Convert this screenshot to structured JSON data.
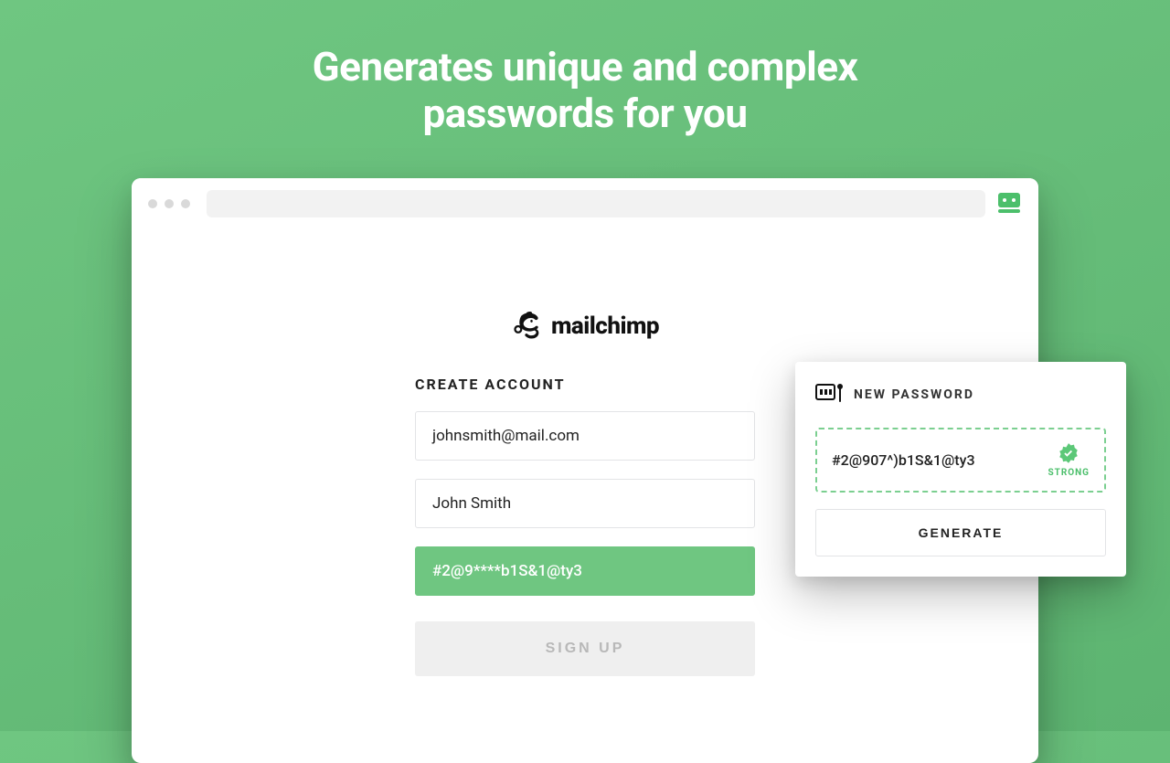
{
  "headline": {
    "line1": "Generates unique and complex",
    "line2": "passwords for you"
  },
  "brand": {
    "name": "mailchimp"
  },
  "form": {
    "heading": "CREATE ACCOUNT",
    "email": "johnsmith@mail.com",
    "name": "John Smith",
    "password_masked": "#2@9****b1S&1@ty3",
    "signup_label": "SIGN UP"
  },
  "popup": {
    "title": "NEW PASSWORD",
    "password": "#2@907^)b1S&1@ty3",
    "strength": "STRONG",
    "generate_label": "GENERATE"
  }
}
